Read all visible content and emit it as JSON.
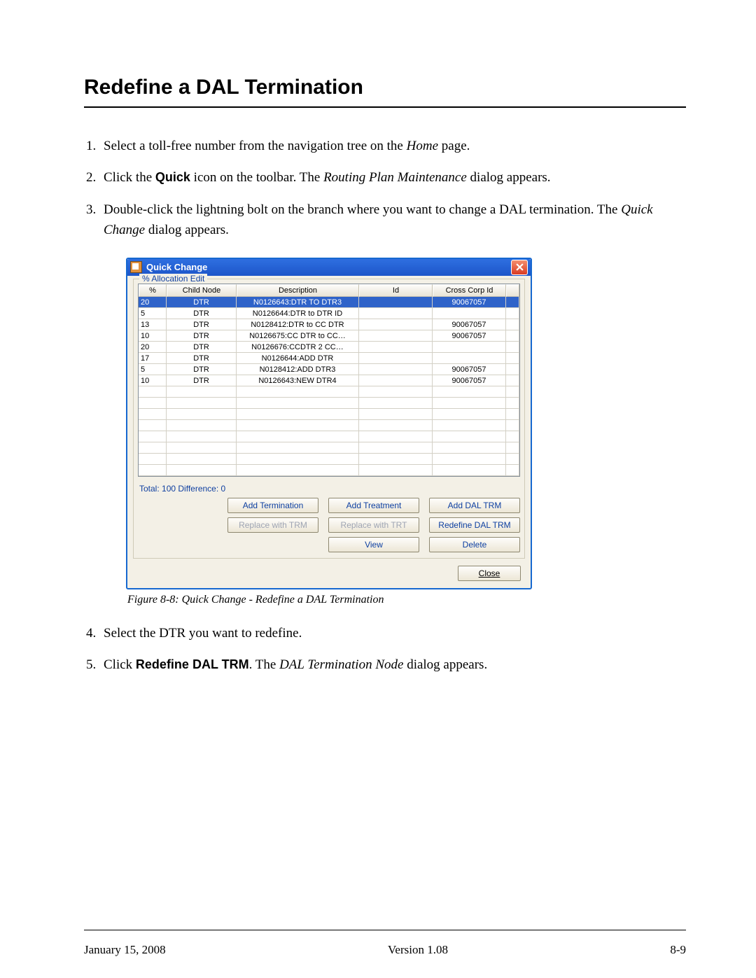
{
  "heading": "Redefine a DAL Termination",
  "steps_top": [
    {
      "n": "1.",
      "parts": [
        {
          "t": "Select a toll-free number from the navigation tree on the "
        },
        {
          "t": "Home",
          "cls": "italic"
        },
        {
          "t": " page."
        }
      ]
    },
    {
      "n": "2.",
      "parts": [
        {
          "t": "Click the "
        },
        {
          "t": "Quick",
          "cls": "bold"
        },
        {
          "t": " icon on the toolbar. The "
        },
        {
          "t": "Routing Plan Maintenance",
          "cls": "italic"
        },
        {
          "t": " dialog appears."
        }
      ]
    },
    {
      "n": "3.",
      "parts": [
        {
          "t": "Double-click the lightning bolt on the branch where you want to change a DAL termination. The "
        },
        {
          "t": "Quick Change",
          "cls": "italic"
        },
        {
          "t": " dialog appears."
        }
      ]
    }
  ],
  "dialog": {
    "title": "Quick Change",
    "group_legend": "% Allocation Edit",
    "columns": {
      "pct": "%",
      "node": "Child Node",
      "desc": "Description",
      "id": "Id",
      "cross": "Cross Corp Id"
    },
    "rows": [
      {
        "pct": "20",
        "node": "DTR",
        "desc": "N0126643:DTR TO DTR3",
        "id": "",
        "cross": "90067057",
        "selected": true
      },
      {
        "pct": "5",
        "node": "DTR",
        "desc": "N0126644:DTR to DTR ID",
        "id": "",
        "cross": ""
      },
      {
        "pct": "13",
        "node": "DTR",
        "desc": "N0128412:DTR to CC DTR",
        "id": "",
        "cross": "90067057"
      },
      {
        "pct": "10",
        "node": "DTR",
        "desc": "N0126675:CC DTR to CC…",
        "id": "",
        "cross": "90067057"
      },
      {
        "pct": "20",
        "node": "DTR",
        "desc": "N0126676:CCDTR 2 CC…",
        "id": "",
        "cross": ""
      },
      {
        "pct": "17",
        "node": "DTR",
        "desc": "N0126644:ADD DTR",
        "id": "",
        "cross": ""
      },
      {
        "pct": "5",
        "node": "DTR",
        "desc": "N0128412:ADD DTR3",
        "id": "",
        "cross": "90067057"
      },
      {
        "pct": "10",
        "node": "DTR",
        "desc": "N0126643:NEW DTR4",
        "id": "",
        "cross": "90067057"
      }
    ],
    "empty_rows": 8,
    "totals": "Total: 100 Difference: 0",
    "buttons": {
      "add_term": "Add Termination",
      "add_treat": "Add Treatment",
      "add_dal": "Add DAL TRM",
      "rep_trm": "Replace with TRM",
      "rep_trt": "Replace with TRT",
      "redef": "Redefine DAL TRM",
      "view": "View",
      "delete": "Delete",
      "close": "Close"
    }
  },
  "figure_caption": "Figure 8-8:   Quick Change - Redefine a DAL Termination",
  "steps_bottom": [
    {
      "n": "4.",
      "parts": [
        {
          "t": "Select the DTR you want to redefine."
        }
      ]
    },
    {
      "n": "5.",
      "parts": [
        {
          "t": "Click "
        },
        {
          "t": "Redefine DAL TRM",
          "cls": "bold"
        },
        {
          "t": ". The "
        },
        {
          "t": "DAL Termination Node",
          "cls": "italic"
        },
        {
          "t": " dialog appears."
        }
      ]
    }
  ],
  "footer": {
    "left": "January 15, 2008",
    "center": "Version 1.08",
    "right": "8-9"
  }
}
